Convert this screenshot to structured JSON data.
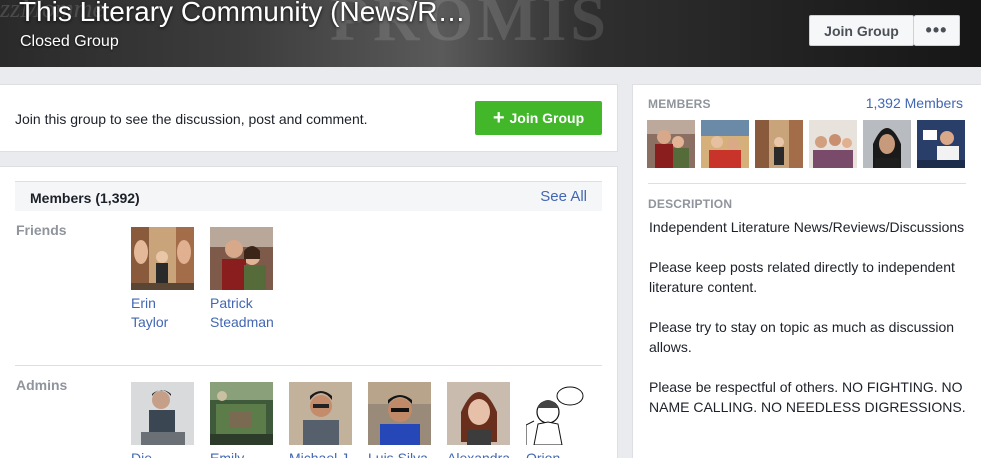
{
  "cover": {
    "title": "This Literary Community (News/R…",
    "subtitle": "Closed Group",
    "join_label": "Join Group",
    "more_label": "•••"
  },
  "join_prompt": {
    "text": "Join this group to see the discussion, post and comment.",
    "button_label": "Join Group",
    "button_icon": "plus-icon",
    "accent": "#42b72a"
  },
  "members_panel": {
    "title": "Members (1,392)",
    "see_all": "See All",
    "friends_label": "Friends",
    "friends": [
      {
        "first": "Erin",
        "last": "Taylor"
      },
      {
        "first": "Patrick",
        "last": "Steadman"
      }
    ],
    "admins_label": "Admins",
    "admins": [
      {
        "name": "Die"
      },
      {
        "name": "Emily"
      },
      {
        "name": "Michael J"
      },
      {
        "name": "Luis Silva"
      },
      {
        "name": "Alexandra"
      },
      {
        "name": "Orion"
      }
    ]
  },
  "sidebar": {
    "members_label": "MEMBERS",
    "members_count": "1,392 Members",
    "description_label": "DESCRIPTION",
    "description": [
      "Independent Literature News/Reviews/Discussions",
      "Please keep posts related directly to independent literature content.",
      "Please try to stay on topic as much as discussion allows.",
      "Please be respectful of others. NO FIGHTING. NO NAME CALLING. NO NEEDLESS DIGRESSIONS."
    ]
  },
  "colors": {
    "link": "#4267b2",
    "muted": "#90949c",
    "background": "#e9ebee"
  }
}
